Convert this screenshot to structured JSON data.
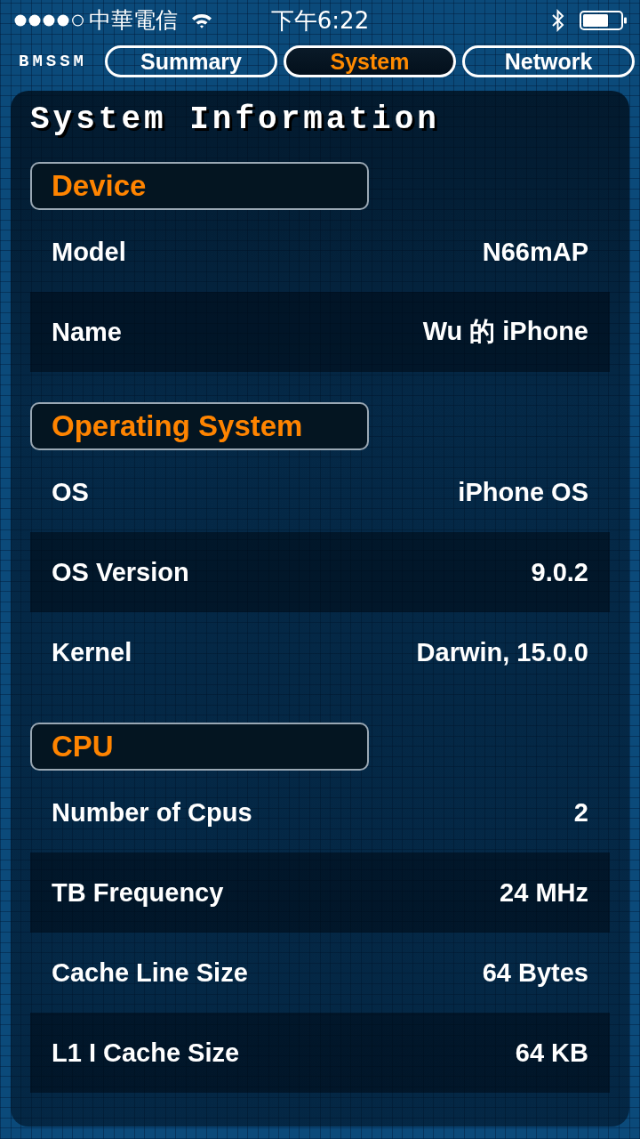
{
  "status_bar": {
    "carrier": "中華電信",
    "time": "下午6:22"
  },
  "app_title": "BMSSM",
  "tabs": [
    {
      "label": "Summary",
      "selected": false
    },
    {
      "label": "System",
      "selected": true
    },
    {
      "label": "Network",
      "selected": false
    }
  ],
  "panel": {
    "title": "System Information",
    "sections": [
      {
        "title": "Device",
        "rows": [
          {
            "label": "Model",
            "value": "N66mAP"
          },
          {
            "label": "Name",
            "value": "Wu 的 iPhone"
          }
        ]
      },
      {
        "title": "Operating System",
        "rows": [
          {
            "label": "OS",
            "value": "iPhone OS"
          },
          {
            "label": "OS Version",
            "value": "9.0.2"
          },
          {
            "label": "Kernel",
            "value": "Darwin, 15.0.0"
          }
        ]
      },
      {
        "title": "CPU",
        "rows": [
          {
            "label": "Number of Cpus",
            "value": "2"
          },
          {
            "label": "TB Frequency",
            "value": "24 MHz"
          },
          {
            "label": "Cache Line Size",
            "value": "64 Bytes"
          },
          {
            "label": "L1 I Cache Size",
            "value": "64 KB"
          }
        ]
      }
    ]
  }
}
